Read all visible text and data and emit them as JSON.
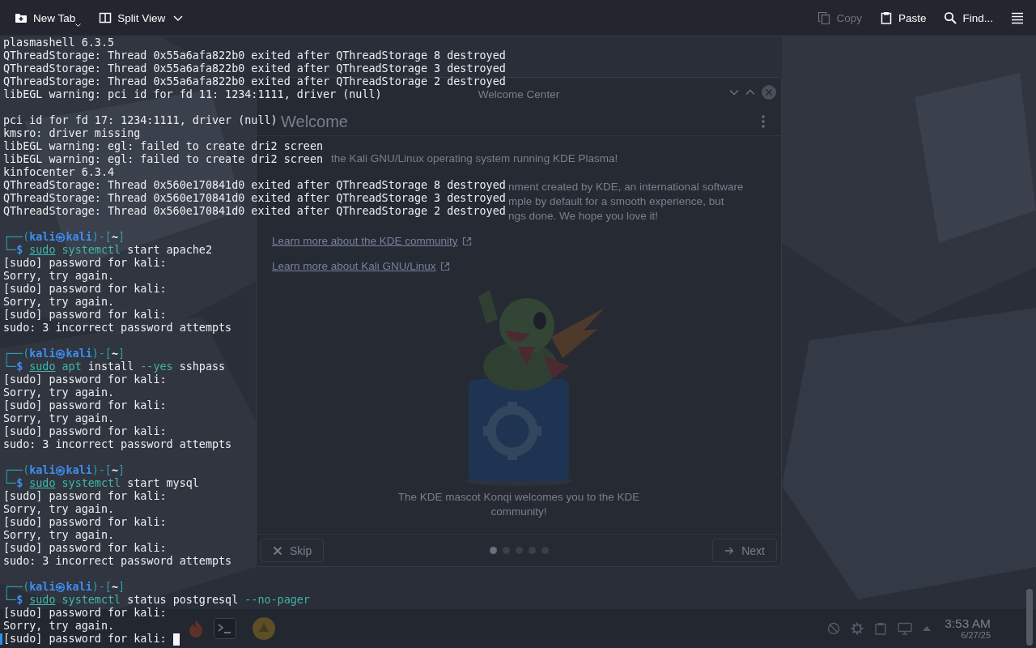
{
  "toolbar": {
    "left": [
      {
        "kind": "new_tab",
        "label": "New Tab",
        "menu": true,
        "disabled": false
      },
      {
        "kind": "split_view",
        "label": "Split View",
        "menu": true,
        "disabled": false
      }
    ],
    "right": [
      {
        "kind": "copy",
        "label": "Copy",
        "menu": false,
        "disabled": true
      },
      {
        "kind": "paste",
        "label": "Paste",
        "menu": false,
        "disabled": false
      },
      {
        "kind": "find",
        "label": "Find...",
        "menu": false,
        "disabled": false
      }
    ]
  },
  "terminal": {
    "cursor": true,
    "lines": [
      {
        "kind": "output",
        "text": "plasmashell 6.3.5"
      },
      {
        "kind": "output",
        "text": "QThreadStorage: Thread 0x55a6afa822b0 exited after QThreadStorage 8 destroyed"
      },
      {
        "kind": "output",
        "text": "QThreadStorage: Thread 0x55a6afa822b0 exited after QThreadStorage 3 destroyed"
      },
      {
        "kind": "output",
        "text": "QThreadStorage: Thread 0x55a6afa822b0 exited after QThreadStorage 2 destroyed"
      },
      {
        "kind": "output",
        "text": "libEGL warning: pci id for fd 11: 1234:1111, driver (null)"
      },
      {
        "kind": "blank"
      },
      {
        "kind": "output",
        "text": "pci id for fd 17: 1234:1111, driver (null)"
      },
      {
        "kind": "output",
        "text": "kmsro: driver missing"
      },
      {
        "kind": "output",
        "text": "libEGL warning: egl: failed to create dri2 screen"
      },
      {
        "kind": "output",
        "text": "libEGL warning: egl: failed to create dri2 screen"
      },
      {
        "kind": "output",
        "text": "kinfocenter 6.3.4"
      },
      {
        "kind": "output",
        "text": "QThreadStorage: Thread 0x560e170841d0 exited after QThreadStorage 8 destroyed"
      },
      {
        "kind": "output",
        "text": "QThreadStorage: Thread 0x560e170841d0 exited after QThreadStorage 3 destroyed"
      },
      {
        "kind": "output",
        "text": "QThreadStorage: Thread 0x560e170841d0 exited after QThreadStorage 2 destroyed"
      },
      {
        "kind": "blank"
      },
      {
        "kind": "prompt",
        "segments": [
          {
            "kind": "frame",
            "text": "┌──("
          },
          {
            "kind": "user",
            "text": "kali㉿kali"
          },
          {
            "kind": "frame",
            "text": ")-["
          },
          {
            "kind": "path",
            "text": "~"
          },
          {
            "kind": "frame",
            "text": "]"
          }
        ]
      },
      {
        "kind": "command",
        "segments": [
          {
            "kind": "frame",
            "text": "└─"
          },
          {
            "kind": "sign",
            "text": "$"
          }
        ],
        "tokens": [
          {
            "kind": "precommand",
            "text": "sudo"
          },
          {
            "kind": "command",
            "text": "systemctl"
          },
          {
            "kind": "argument",
            "text": "start"
          },
          {
            "kind": "argument",
            "text": "apache2"
          }
        ]
      },
      {
        "kind": "output",
        "text": "[sudo] password for kali:"
      },
      {
        "kind": "output",
        "text": "Sorry, try again."
      },
      {
        "kind": "output",
        "text": "[sudo] password for kali:"
      },
      {
        "kind": "output",
        "text": "Sorry, try again."
      },
      {
        "kind": "output",
        "text": "[sudo] password for kali:"
      },
      {
        "kind": "output",
        "text": "sudo: 3 incorrect password attempts"
      },
      {
        "kind": "blank"
      },
      {
        "kind": "prompt",
        "segments": [
          {
            "kind": "frame",
            "text": "┌──("
          },
          {
            "kind": "user",
            "text": "kali㉿kali"
          },
          {
            "kind": "frame",
            "text": ")-["
          },
          {
            "kind": "path",
            "text": "~"
          },
          {
            "kind": "frame",
            "text": "]"
          }
        ]
      },
      {
        "kind": "command",
        "segments": [
          {
            "kind": "frame",
            "text": "└─"
          },
          {
            "kind": "sign",
            "text": "$"
          }
        ],
        "tokens": [
          {
            "kind": "precommand",
            "text": "sudo"
          },
          {
            "kind": "command",
            "text": "apt"
          },
          {
            "kind": "argument",
            "text": "install"
          },
          {
            "kind": "option",
            "text": "--yes"
          },
          {
            "kind": "argument",
            "text": "sshpass"
          }
        ]
      },
      {
        "kind": "output",
        "text": "[sudo] password for kali:"
      },
      {
        "kind": "output",
        "text": "Sorry, try again."
      },
      {
        "kind": "output",
        "text": "[sudo] password for kali:"
      },
      {
        "kind": "output",
        "text": "Sorry, try again."
      },
      {
        "kind": "output",
        "text": "[sudo] password for kali:"
      },
      {
        "kind": "output",
        "text": "sudo: 3 incorrect password attempts"
      },
      {
        "kind": "blank"
      },
      {
        "kind": "prompt",
        "segments": [
          {
            "kind": "frame",
            "text": "┌──("
          },
          {
            "kind": "user",
            "text": "kali㉿kali"
          },
          {
            "kind": "frame",
            "text": ")-["
          },
          {
            "kind": "path",
            "text": "~"
          },
          {
            "kind": "frame",
            "text": "]"
          }
        ]
      },
      {
        "kind": "command",
        "segments": [
          {
            "kind": "frame",
            "text": "└─"
          },
          {
            "kind": "sign",
            "text": "$"
          }
        ],
        "tokens": [
          {
            "kind": "precommand",
            "text": "sudo"
          },
          {
            "kind": "command",
            "text": "systemctl"
          },
          {
            "kind": "argument",
            "text": "start"
          },
          {
            "kind": "argument",
            "text": "mysql"
          }
        ]
      },
      {
        "kind": "output",
        "text": "[sudo] password for kali:"
      },
      {
        "kind": "output",
        "text": "Sorry, try again."
      },
      {
        "kind": "output",
        "text": "[sudo] password for kali:"
      },
      {
        "kind": "output",
        "text": "Sorry, try again."
      },
      {
        "kind": "output",
        "text": "[sudo] password for kali:"
      },
      {
        "kind": "output",
        "text": "sudo: 3 incorrect password attempts"
      },
      {
        "kind": "blank"
      },
      {
        "kind": "prompt",
        "segments": [
          {
            "kind": "frame",
            "text": "┌──("
          },
          {
            "kind": "user",
            "text": "kali㉿kali"
          },
          {
            "kind": "frame",
            "text": ")-["
          },
          {
            "kind": "path",
            "text": "~"
          },
          {
            "kind": "frame",
            "text": "]"
          }
        ]
      },
      {
        "kind": "command",
        "segments": [
          {
            "kind": "frame",
            "text": "└─"
          },
          {
            "kind": "sign",
            "text": "$"
          }
        ],
        "tokens": [
          {
            "kind": "precommand",
            "text": "sudo"
          },
          {
            "kind": "command",
            "text": "systemctl"
          },
          {
            "kind": "argument",
            "text": "status"
          },
          {
            "kind": "argument",
            "text": "postgresql"
          },
          {
            "kind": "option",
            "text": "--no-pager"
          }
        ]
      },
      {
        "kind": "output",
        "text": "[sudo] password for kali:"
      },
      {
        "kind": "output",
        "text": "Sorry, try again."
      },
      {
        "kind": "output",
        "text": "[sudo] password for kali:"
      }
    ]
  },
  "welcome_window": {
    "title": "Welcome Center",
    "heading": "Welcome",
    "intro": "the Kali GNU/Linux operating system running KDE Plasma!",
    "description_lines": [
      "nment created by KDE, an international software",
      "mple by default for a smooth experience, but",
      "ngs done. We hope you love it!"
    ],
    "links": [
      "Learn more about the KDE community",
      "Learn more about Kali GNU/Linux"
    ],
    "caption": "The KDE mascot Konqi welcomes you to the KDE community!",
    "skip": "Skip",
    "next": "Next",
    "pages": [
      {
        "selected": true
      },
      {
        "selected": false
      },
      {
        "selected": false
      },
      {
        "selected": false
      },
      {
        "selected": false
      }
    ]
  },
  "taskbar": {
    "time": "3:53 AM",
    "date": "6/27/25"
  }
}
